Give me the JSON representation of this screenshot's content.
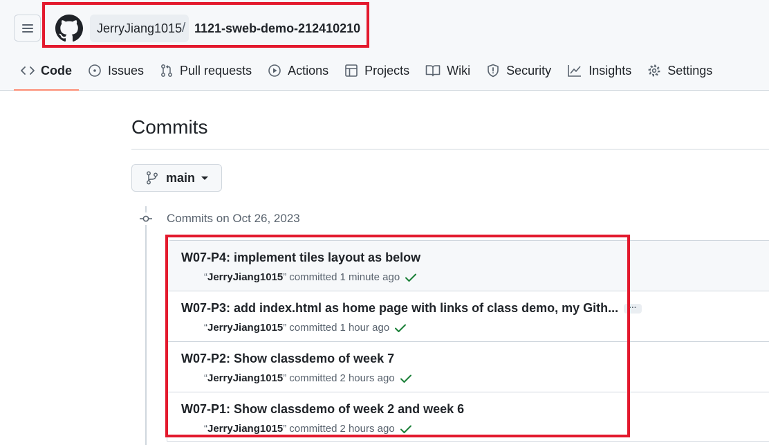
{
  "header": {
    "owner": "JerryJiang1015",
    "separator": "/",
    "repo": "1121-sweb-demo-212410210"
  },
  "tabs": [
    {
      "label": "Code",
      "icon": "code-icon"
    },
    {
      "label": "Issues",
      "icon": "issue-icon"
    },
    {
      "label": "Pull requests",
      "icon": "pull-request-icon"
    },
    {
      "label": "Actions",
      "icon": "play-icon"
    },
    {
      "label": "Projects",
      "icon": "table-icon"
    },
    {
      "label": "Wiki",
      "icon": "book-icon"
    },
    {
      "label": "Security",
      "icon": "shield-icon"
    },
    {
      "label": "Insights",
      "icon": "graph-icon"
    },
    {
      "label": "Settings",
      "icon": "gear-icon"
    }
  ],
  "page": {
    "title": "Commits",
    "branch": "main",
    "group_label": "Commits on Oct 26, 2023"
  },
  "commits": [
    {
      "message": "W07-P4: implement tiles layout as below",
      "author": "JerryJiang1015",
      "verb": "committed",
      "time": "1 minute ago"
    },
    {
      "message": "W07-P3: add index.html as home page with links of class demo, my Gith...",
      "author": "JerryJiang1015",
      "verb": "committed",
      "time": "1 hour ago",
      "expand_label": "···"
    },
    {
      "message": "W07-P2: Show classdemo of week 7",
      "author": "JerryJiang1015",
      "verb": "committed",
      "time": "2 hours ago"
    },
    {
      "message": "W07-P1: Show classdemo of week 2 and week 6",
      "author": "JerryJiang1015",
      "verb": "committed",
      "time": "2 hours ago"
    }
  ],
  "colors": {
    "highlight": "#e3192d",
    "check": "#1a7f37",
    "active_tab_underline": "#fd8c73"
  }
}
